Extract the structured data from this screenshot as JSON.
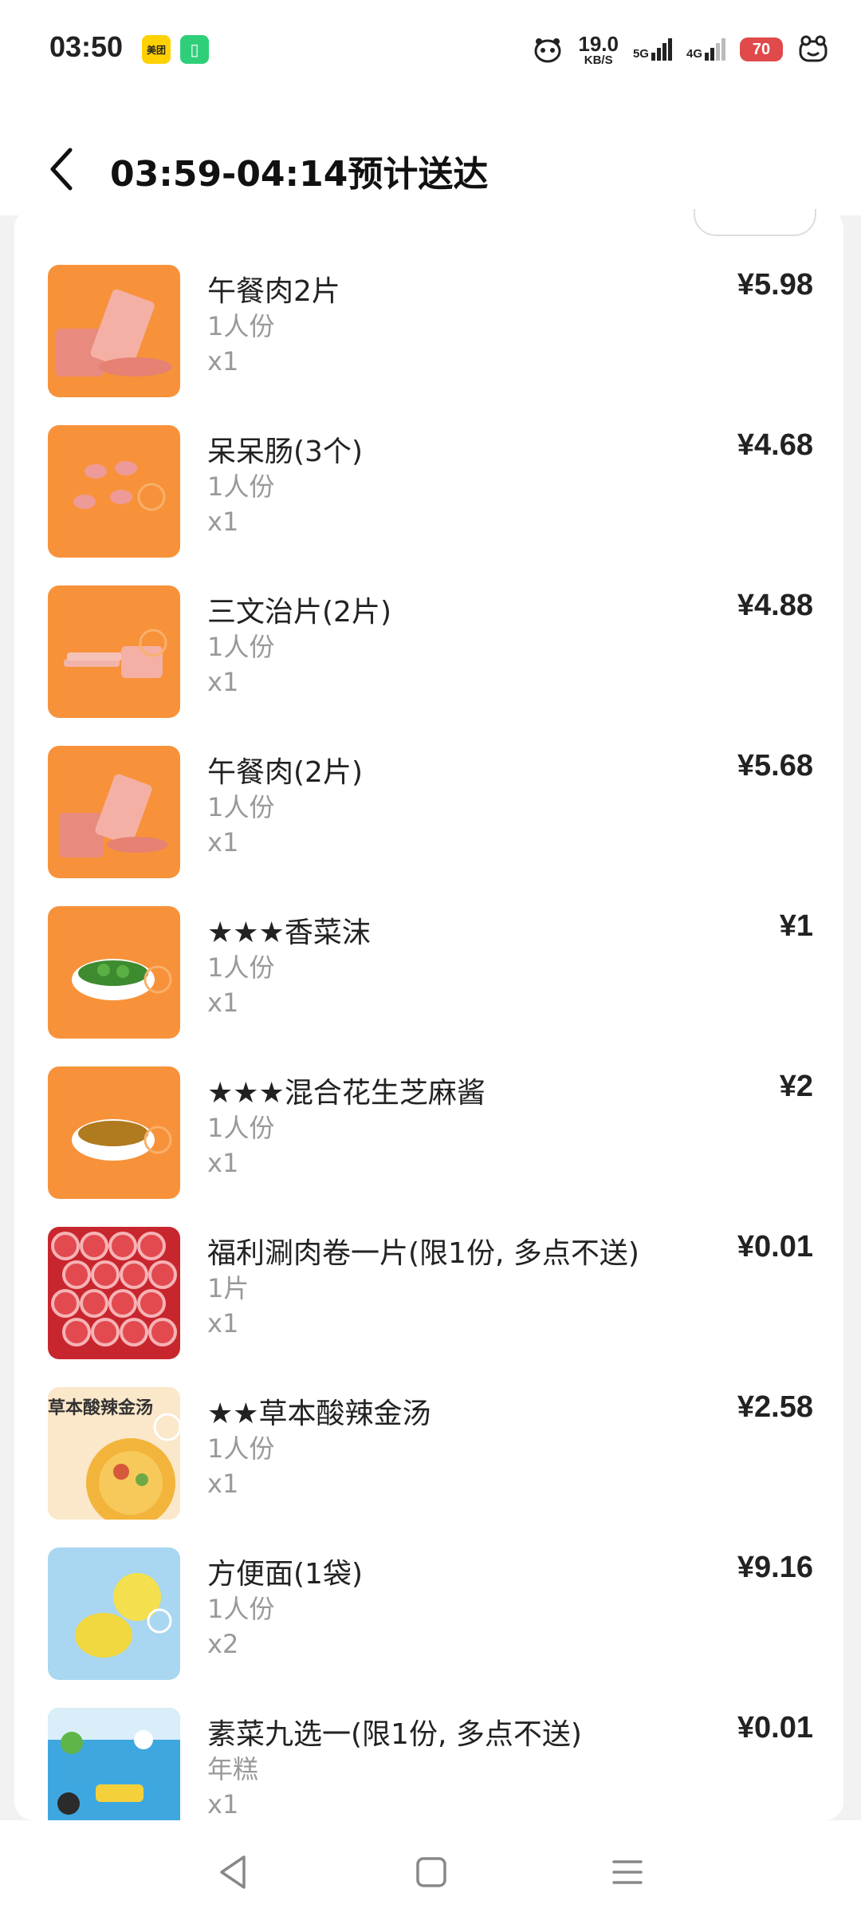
{
  "status_bar": {
    "time": "03:50",
    "meituan_badge": "美团",
    "net_speed_value": "19.0",
    "net_speed_unit": "KB/S",
    "sim1": "5G",
    "sim2": "4G",
    "battery": "70"
  },
  "header": {
    "title": "03:59-04:14预计送达"
  },
  "items": [
    {
      "name": "午餐肉2片",
      "spec": "1人份",
      "qty": "x1",
      "price": "¥5.98",
      "thumb_color": "#f7923a",
      "icon": "luncheon-meat"
    },
    {
      "name": "呆呆肠(3个)",
      "spec": "1人份",
      "qty": "x1",
      "price": "¥4.68",
      "thumb_color": "#f7923a",
      "icon": "sausage"
    },
    {
      "name": "三文治片(2片)",
      "spec": "1人份",
      "qty": "x1",
      "price": "¥4.88",
      "thumb_color": "#f7923a",
      "icon": "sandwich-meat"
    },
    {
      "name": "午餐肉(2片)",
      "spec": "1人份",
      "qty": "x1",
      "price": "¥5.68",
      "thumb_color": "#f7923a",
      "icon": "luncheon-meat"
    },
    {
      "name": "★★★香菜沫",
      "spec": "1人份",
      "qty": "x1",
      "price": "¥1",
      "thumb_color": "#f7923a",
      "icon": "cilantro-bowl"
    },
    {
      "name": "★★★混合花生芝麻酱",
      "spec": "1人份",
      "qty": "x1",
      "price": "¥2",
      "thumb_color": "#f7923a",
      "icon": "sesame-sauce-bowl"
    },
    {
      "name": "福利涮肉卷一片(限1份, 多点不送)",
      "spec": "1片",
      "qty": "x1",
      "price": "¥0.01",
      "thumb_color": "#c8262e",
      "icon": "meat-rolls"
    },
    {
      "name": "★★草本酸辣金汤",
      "spec": "1人份",
      "qty": "x1",
      "price": "¥2.58",
      "thumb_color": "#fbe7c9",
      "icon": "soup-base",
      "thumb_text": "草本酸辣金汤"
    },
    {
      "name": "方便面(1袋)",
      "spec": "1人份",
      "qty": "x2",
      "price": "¥9.16",
      "thumb_color": "#a9d6f0",
      "icon": "instant-noodles"
    },
    {
      "name": "素菜九选一(限1份, 多点不送)",
      "spec": "年糕",
      "qty": "x1",
      "price": "¥0.01",
      "thumb_color": "#3fa7e0",
      "icon": "vegetables"
    }
  ]
}
